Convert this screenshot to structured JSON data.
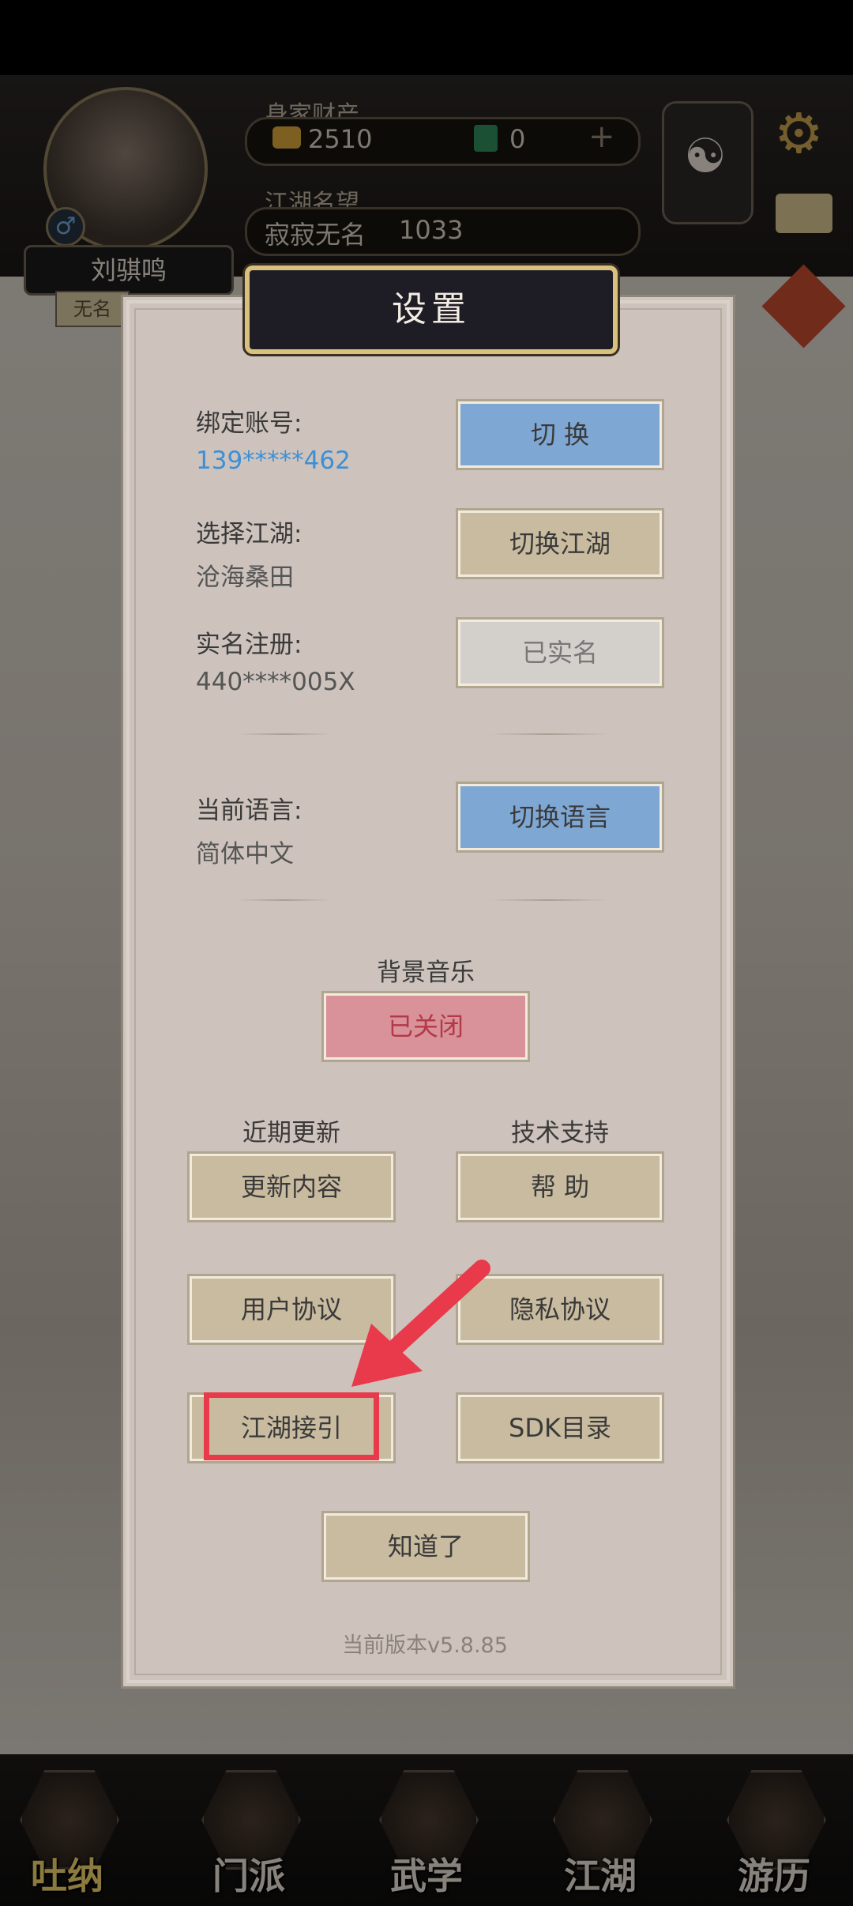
{
  "top": {
    "avatar_name": "刘骐鸣",
    "rank_badge": "无名",
    "gender_symbol": "♂",
    "wealth_label": "身家财产",
    "gold_value": "2510",
    "jade_value": "0",
    "plus_symbol": "+",
    "fame_label": "江湖名望",
    "fame_title": "寂寂无名",
    "fame_value": "1033",
    "taiji_symbol": "☯",
    "gear_symbol": "⚙"
  },
  "nav": {
    "items": [
      {
        "label": "吐纳"
      },
      {
        "label": "门派"
      },
      {
        "label": "武学"
      },
      {
        "label": "江湖"
      },
      {
        "label": "游历"
      }
    ]
  },
  "dialog": {
    "title": "设置",
    "account_label": "绑定账号:",
    "account_value": "139*****462",
    "account_button": "切 换",
    "world_label": "选择江湖:",
    "world_value": "沧海桑田",
    "world_button": "切换江湖",
    "realname_label": "实名注册:",
    "realname_value": "440****005X",
    "realname_button": "已实名",
    "language_label": "当前语言:",
    "language_value": "简体中文",
    "language_button": "切换语言",
    "music_label": "背景音乐",
    "music_button": "已关闭",
    "updates_label": "近期更新",
    "updates_button": "更新内容",
    "support_label": "技术支持",
    "support_button": "帮 助",
    "user_agreement_button": "用户协议",
    "privacy_button": "隐私协议",
    "guide_button": "江湖接引",
    "sdk_button": "SDK目录",
    "ok_button": "知道了",
    "version": "当前版本v5.8.85"
  },
  "colors": {
    "annotation_red": "#e83a4a",
    "blue_button": "#7fa7d3",
    "tan_button": "#c9bb9f"
  }
}
